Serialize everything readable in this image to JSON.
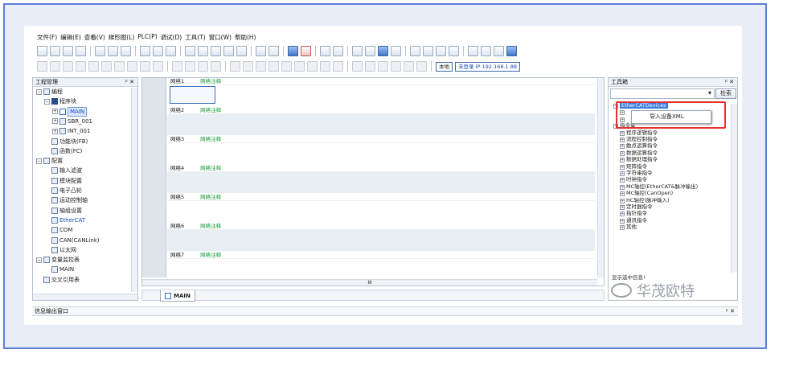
{
  "menu": [
    "文件(F)",
    "编辑(E)",
    "查看(V)",
    "梯形图(L)",
    "PLC(P)",
    "调试(D)",
    "工具(T)",
    "窗口(W)",
    "帮助(H)"
  ],
  "toolbar": {
    "local_label": "本地",
    "login_label": "未登录 IP:192.168.1.88"
  },
  "project_panel": {
    "title": "工程管理",
    "pin": "ᵖ ✕",
    "tree": [
      {
        "label": "编程",
        "level": 0,
        "expander": "⊟"
      },
      {
        "label": "程序块",
        "level": 1,
        "expander": "⊟"
      },
      {
        "label": "MAIN",
        "level": 2,
        "expander": "⊞",
        "selected": true
      },
      {
        "label": "SBR_001",
        "level": 2,
        "expander": "⊞"
      },
      {
        "label": "INT_001",
        "level": 2,
        "expander": "⊞"
      },
      {
        "label": "功能块(FB)",
        "level": 1,
        "expander": ""
      },
      {
        "label": "函数(FC)",
        "level": 1,
        "expander": ""
      },
      {
        "label": "配置",
        "level": 0,
        "expander": "⊟"
      },
      {
        "label": "输入滤波",
        "level": 1,
        "expander": ""
      },
      {
        "label": "模块配置",
        "level": 1,
        "expander": ""
      },
      {
        "label": "电子凸轮",
        "level": 1,
        "expander": ""
      },
      {
        "label": "运动控制轴",
        "level": 1,
        "expander": ""
      },
      {
        "label": "轴组设置",
        "level": 1,
        "expander": ""
      },
      {
        "label": "EtherCAT",
        "level": 1,
        "expander": "",
        "highlight": true
      },
      {
        "label": "COM",
        "level": 1,
        "expander": ""
      },
      {
        "label": "CAN(CANLink)",
        "level": 1,
        "expander": ""
      },
      {
        "label": "以太网",
        "level": 1,
        "expander": ""
      },
      {
        "label": "变量监控表",
        "level": 0,
        "expander": "⊟"
      },
      {
        "label": "MAIN",
        "level": 1,
        "expander": ""
      },
      {
        "label": "交叉引用表",
        "level": 0,
        "expander": ""
      }
    ]
  },
  "ladder": {
    "networks": [
      {
        "name": "网络1",
        "comment": "网络注释"
      },
      {
        "name": "网络2",
        "comment": "网络注释"
      },
      {
        "name": "网络3",
        "comment": "网络注释"
      },
      {
        "name": "网络4",
        "comment": "网络注释"
      },
      {
        "name": "网络5",
        "comment": "网络注释"
      },
      {
        "name": "网络6",
        "comment": "网络注释"
      },
      {
        "name": "网络7",
        "comment": "网络注释"
      }
    ],
    "tab_label": "MAIN",
    "hscroll_mark": "III"
  },
  "tools_panel": {
    "title": "工具箱",
    "pin": "ᵖ ✕",
    "search_button": "检索",
    "dropdown_arrow": "▾",
    "items": [
      {
        "label": "EtherCATDevices",
        "expander": "⊟",
        "indent": 0,
        "selected": true
      },
      {
        "label": "",
        "expander": "⊞",
        "indent": 1
      },
      {
        "label": "",
        "expander": "⊞",
        "indent": 1
      },
      {
        "label": "指令集",
        "expander": "⊟",
        "indent": 0
      },
      {
        "label": "程序逻辑指令",
        "expander": "⊞",
        "indent": 1
      },
      {
        "label": "流程控制指令",
        "expander": "⊞",
        "indent": 1
      },
      {
        "label": "触点运算指令",
        "expander": "⊞",
        "indent": 1
      },
      {
        "label": "数据运算指令",
        "expander": "⊞",
        "indent": 1
      },
      {
        "label": "数据处理指令",
        "expander": "⊞",
        "indent": 1
      },
      {
        "label": "矩阵指令",
        "expander": "⊞",
        "indent": 1
      },
      {
        "label": "字符串指令",
        "expander": "⊞",
        "indent": 1
      },
      {
        "label": "时钟指令",
        "expander": "⊞",
        "indent": 1
      },
      {
        "label": "MC轴控(EtherCAT&脉冲输出)",
        "expander": "⊞",
        "indent": 1
      },
      {
        "label": "MC轴控(CanOpen)",
        "expander": "⊞",
        "indent": 1
      },
      {
        "label": "HC轴控(脉冲输入)",
        "expander": "⊞",
        "indent": 1
      },
      {
        "label": "定时器指令",
        "expander": "⊞",
        "indent": 1
      },
      {
        "label": "指针指令",
        "expander": "⊞",
        "indent": 1
      },
      {
        "label": "通讯指令",
        "expander": "⊞",
        "indent": 1
      },
      {
        "label": "其他",
        "expander": "⊞",
        "indent": 1
      }
    ],
    "info_label": "显示选中信息!",
    "context_menu": "导入设备XML"
  },
  "output_panel": {
    "title": "信息输出窗口",
    "pin": "ᵖ ✕"
  },
  "watermark": "华茂欧特",
  "colors": {
    "frame": "#5a7fd6",
    "highlight_box": "#e53030",
    "comment_green": "#1a9a3a"
  }
}
